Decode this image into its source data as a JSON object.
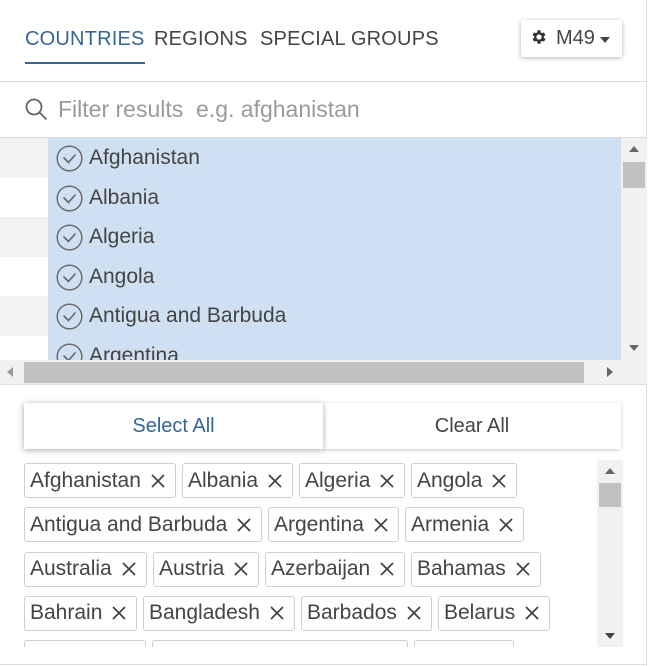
{
  "tabs": [
    {
      "label": "COUNTRIES",
      "active": true
    },
    {
      "label": "REGIONS",
      "active": false
    },
    {
      "label": "SPECIAL GROUPS",
      "active": false
    }
  ],
  "classification": {
    "label": "M49",
    "icon": "gear-icon"
  },
  "filter": {
    "placeholder": "Filter results  e.g. afghanistan",
    "value": ""
  },
  "list": {
    "items": [
      "Afghanistan",
      "Albania",
      "Algeria",
      "Angola",
      "Antigua and Barbuda",
      "Argentina"
    ],
    "selected_color": "#cfe0f2",
    "stripe_color": "#f2f2f2"
  },
  "actions": {
    "select_all": "Select All",
    "clear_all": "Clear All"
  },
  "selected_chips": [
    "Afghanistan",
    "Albania",
    "Algeria",
    "Angola",
    "Antigua and Barbuda",
    "Argentina",
    "Armenia",
    "Australia",
    "Austria",
    "Azerbaijan",
    "Bahamas",
    "Bahrain",
    "Bangladesh",
    "Barbados",
    "Belarus"
  ],
  "colors": {
    "accent": "#336699",
    "text": "#444444"
  }
}
